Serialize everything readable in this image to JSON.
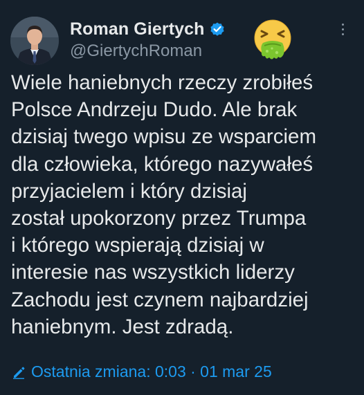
{
  "tweet": {
    "author": {
      "display_name": "Roman Giertych",
      "handle": "@GiertychRoman",
      "verified_icon": "verified-badge-icon",
      "avatar": "profile-photo-man-in-suit"
    },
    "emoji": "nauseated-face-emoji",
    "more_icon": "more-options-icon",
    "text_lines": [
      "Wiele haniebnych rzeczy zrobiłeś",
      "Polsce Andrzeju Dudo. Ale brak",
      "dzisiaj twego wpisu ze wsparciem",
      "dla człowieka, którego nazywałeś",
      "przyjacielem i który dzisiaj",
      "został upokorzony przez Trumpa",
      "i którego wspierają dzisiaj w",
      "interesie nas wszystkich liderzy",
      "Zachodu jest czynem najbardziej",
      "haniebnym. Jest zdradą."
    ],
    "edited_label": "Ostatnia zmiana: 0:03 · 01 mar 25"
  },
  "colors": {
    "background": "#15202b",
    "text": "#e7e9ea",
    "secondary": "#8b98a5",
    "accent": "#1d9bf0"
  }
}
